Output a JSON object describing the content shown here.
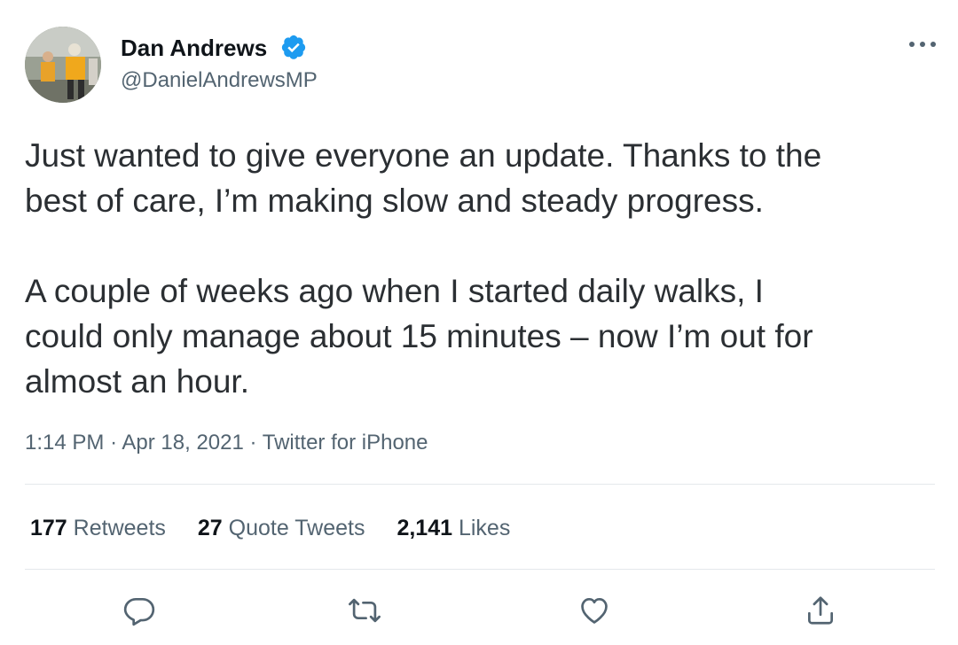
{
  "author": {
    "name": "Dan Andrews",
    "handle": "@DanielAndrewsMP"
  },
  "tweet": {
    "text": "Just wanted to give everyone an update. Thanks to the\nbest of care, I’m making slow and steady progress.\n\nA couple of weeks ago when I started daily walks, I\ncould only manage about 15 minutes – now I’m out for\nalmost an hour.",
    "time": "1:14 PM",
    "separator": "·",
    "date": "Apr 18, 2021",
    "source": "Twitter for iPhone"
  },
  "stats": {
    "retweets_count": "177",
    "retweets_label": "Retweets",
    "quotes_count": "27",
    "quotes_label": "Quote Tweets",
    "likes_count": "2,141",
    "likes_label": "Likes"
  },
  "icons": {
    "verified": "verified-badge-icon",
    "more": "more-options-icon",
    "reply": "reply-icon",
    "retweet": "retweet-icon",
    "like": "heart-icon",
    "share": "share-icon"
  },
  "colors": {
    "verified_blue": "#1d9bf0",
    "secondary_text": "#536471",
    "primary_text": "#0f1419"
  }
}
